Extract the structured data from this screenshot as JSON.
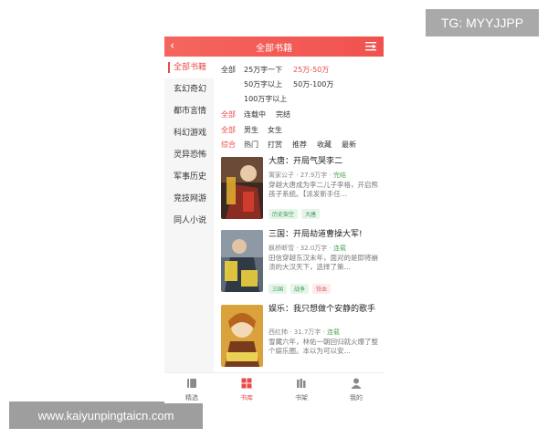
{
  "watermarks": {
    "top": "TG: MYYJJPP",
    "bottom": "www.kaiyunpingtaicn.com"
  },
  "header": {
    "title": "全部书籍",
    "back": "‹"
  },
  "sidebar": {
    "items": [
      {
        "label": "全部书籍",
        "active": true
      },
      {
        "label": "玄幻奇幻"
      },
      {
        "label": "都市言情"
      },
      {
        "label": "科幻游戏"
      },
      {
        "label": "灵异恐怖"
      },
      {
        "label": "军事历史"
      },
      {
        "label": "竞技网游"
      },
      {
        "label": "同人小说"
      }
    ]
  },
  "filters": {
    "wordcount": {
      "all": "全部",
      "options": [
        "25万字一下",
        "25万-50万",
        "50万字以上",
        "50万-100万",
        "100万字以上"
      ]
    },
    "status": {
      "all": "全部",
      "options": [
        "连载中",
        "完结"
      ]
    },
    "gender": {
      "all": "全部",
      "options": [
        "男生",
        "女生"
      ]
    },
    "sort": {
      "all": "综合",
      "options": [
        "热门",
        "打赏",
        "推荐",
        "收藏",
        "最新"
      ]
    }
  },
  "books": [
    {
      "title": "大唐：开局气哭李二",
      "author": "寓家公子",
      "words": "27.9万字",
      "status": "完结",
      "desc": "穿越大唐成为李二儿子李格，开启熊孩子系统。【派发新手任…",
      "tags": [
        "历史架空",
        "大唐"
      ]
    },
    {
      "title": "三国：开局劫道曹操大军!",
      "author": "枫桥断雪",
      "words": "32.0万字",
      "status": "连载",
      "desc": "田信穿越东汉末年，面对的是即将崩溃的大汉天下，选择了策…",
      "tags": [
        "三国",
        "战争",
        "铁血"
      ]
    },
    {
      "title": "娱乐：我只想做个安静的歌手",
      "author": "西红柿",
      "words": "31.7万字",
      "status": "连载",
      "desc": "雪藏六年，林佑一朝回归就火爆了整个娱乐圈。本以为可以安…",
      "tags": []
    }
  ],
  "tabbar": [
    {
      "label": "精选",
      "icon": "book-icon"
    },
    {
      "label": "书库",
      "icon": "grid-icon",
      "active": true
    },
    {
      "label": "书架",
      "icon": "shelf-icon"
    },
    {
      "label": "我的",
      "icon": "person-icon"
    }
  ],
  "colors": {
    "accent": "#e94a47",
    "header": "#f0524f",
    "status_green": "#57a85a"
  }
}
